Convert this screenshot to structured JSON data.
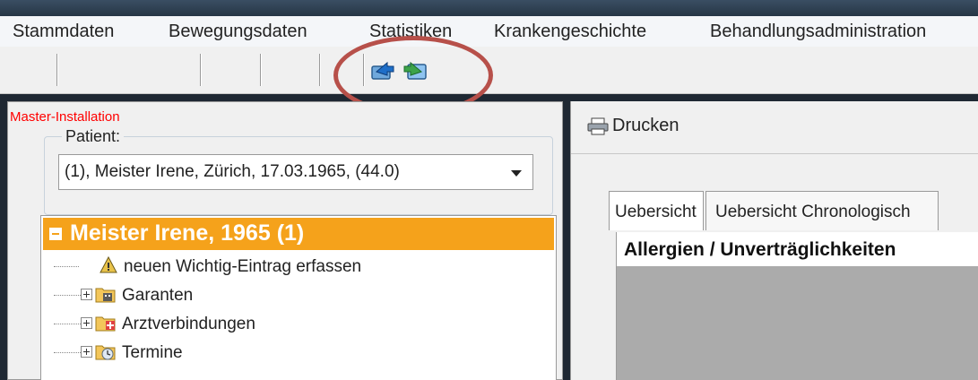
{
  "menu": {
    "items": [
      {
        "label": "Stammdaten"
      },
      {
        "label": "Bewegungsdaten"
      },
      {
        "label": "Statistiken"
      },
      {
        "label": "Krankengeschichte"
      },
      {
        "label": "Behandlungsadministration"
      }
    ]
  },
  "toolbar": {
    "buttons": [
      {
        "icon": "export-arrow-icon"
      },
      {
        "icon": "import-arrow-icon"
      }
    ]
  },
  "left_pane": {
    "installation_label": "Master-Installation",
    "patient_label": "Patient:",
    "patient_value": "(1), Meister Irene, Zürich, 17.03.1965, (44.0)",
    "tree": {
      "header": "Meister Irene, 1965 (1)",
      "items": [
        {
          "label": "neuen Wichtig-Eintrag erfassen",
          "icon": "warning-sign-icon",
          "expandable": false
        },
        {
          "label": "Garanten",
          "icon": "folder-building-icon",
          "expandable": true
        },
        {
          "label": "Arztverbindungen",
          "icon": "folder-medical-icon",
          "expandable": true
        },
        {
          "label": "Termine",
          "icon": "folder-clock-icon",
          "expandable": true
        }
      ]
    }
  },
  "right_pane": {
    "print_label": "Drucken",
    "tabs": [
      {
        "label": "Uebersicht"
      },
      {
        "label": "Uebersicht Chronologisch"
      }
    ],
    "section_title": "Allergien / Unverträglichkeiten"
  },
  "colors": {
    "accent_orange": "#f5a21b",
    "highlight_ring": "#b7504a",
    "install_label": "#ff0000"
  }
}
